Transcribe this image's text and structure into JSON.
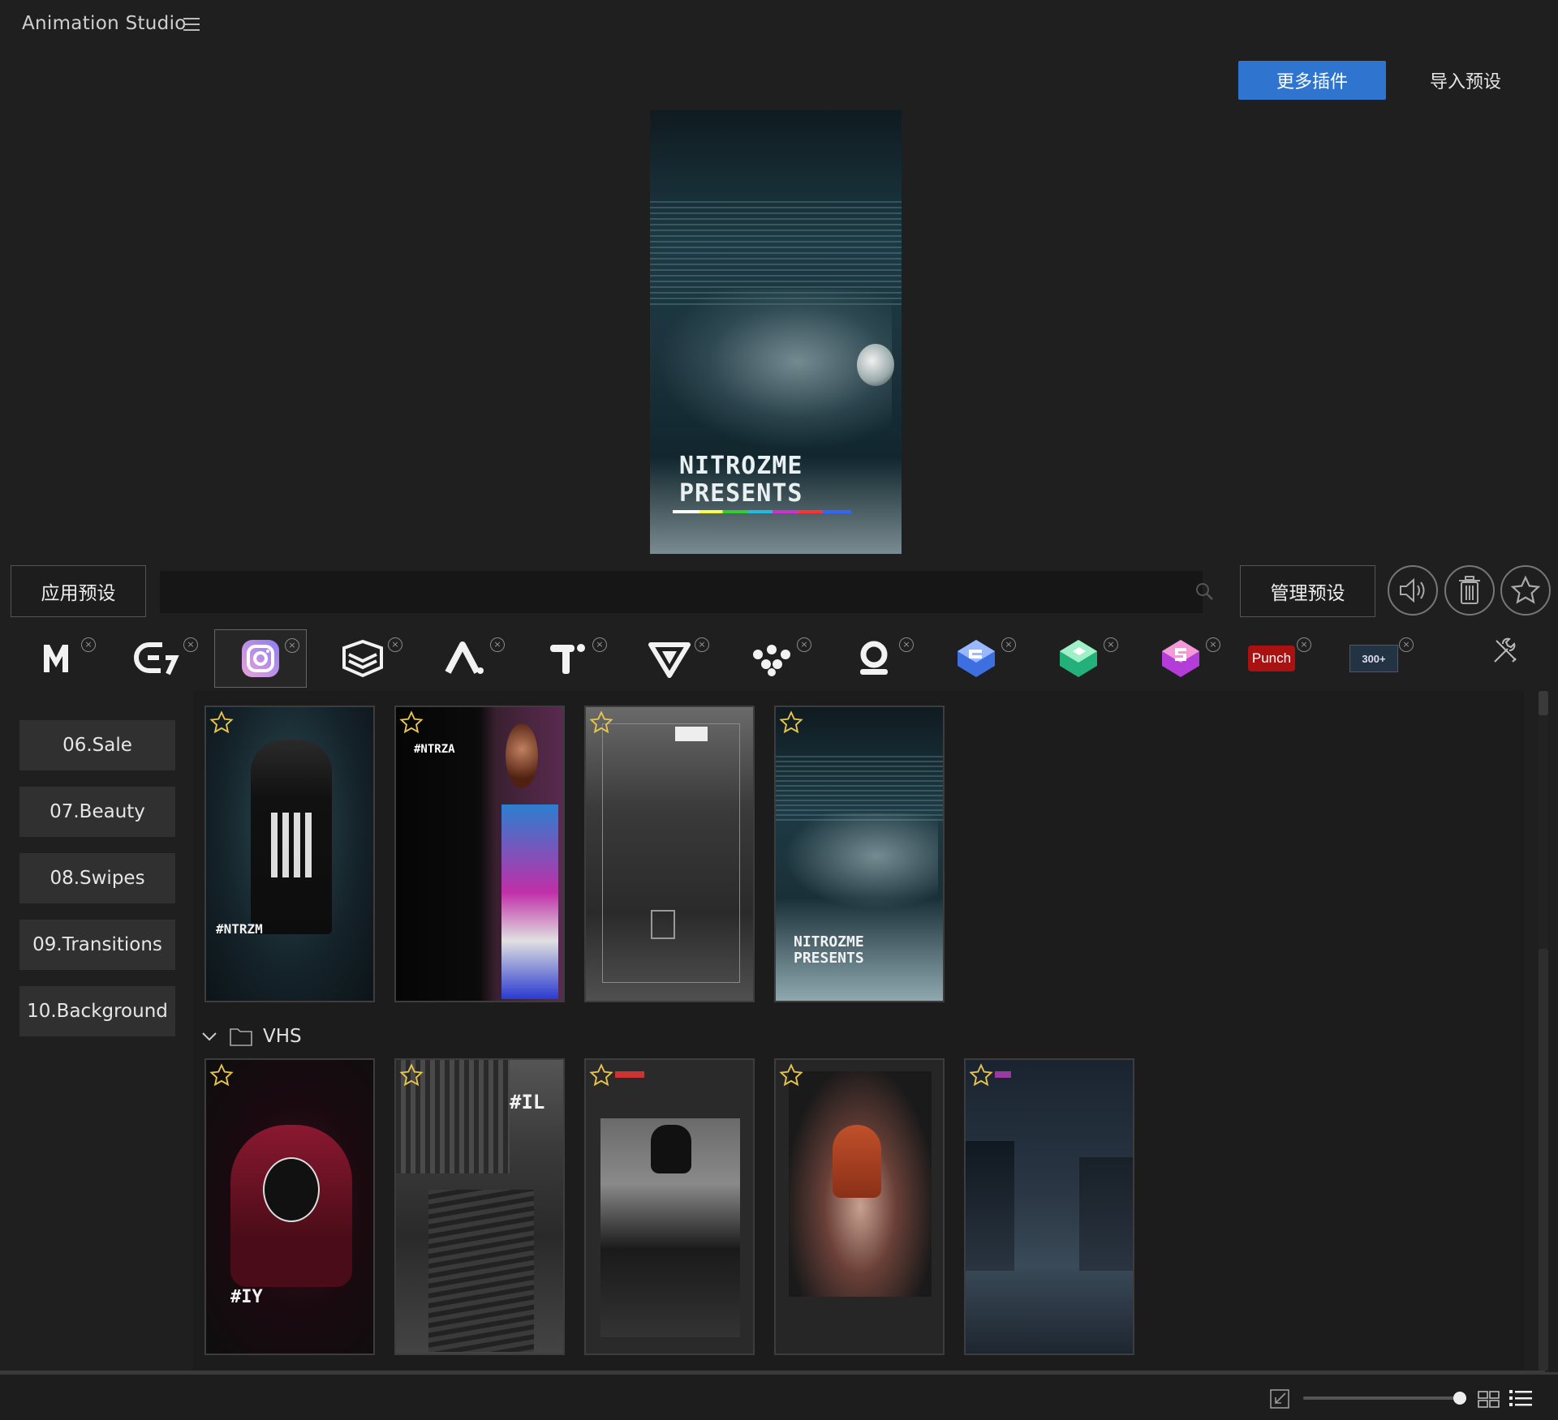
{
  "app": {
    "title": "Animation Studio"
  },
  "header": {
    "more_plugins": "更多插件",
    "import_preset": "导入预设"
  },
  "preview": {
    "line1": "NITROZME",
    "line2": "PRESENTS"
  },
  "toolbar": {
    "apply_preset": "应用预设",
    "manage_preset": "管理预设",
    "search_placeholder": ""
  },
  "plugins": [
    {
      "name": "M",
      "icon": "m-logo-icon"
    },
    {
      "name": "E7",
      "icon": "e7-logo-icon"
    },
    {
      "name": "Instagram",
      "icon": "instagram-icon",
      "active": true
    },
    {
      "name": "Layers",
      "icon": "layers-logo-icon"
    },
    {
      "name": "A",
      "icon": "a-logo-icon"
    },
    {
      "name": "T",
      "icon": "t-logo-icon"
    },
    {
      "name": "V",
      "icon": "v-logo-icon"
    },
    {
      "name": "Dots",
      "icon": "dots-logo-icon"
    },
    {
      "name": "Q",
      "icon": "q-logo-icon"
    },
    {
      "name": "Blue",
      "icon": "blue-cube-icon"
    },
    {
      "name": "Green",
      "icon": "green-cube-icon"
    },
    {
      "name": "Pink",
      "icon": "pink-cube-icon"
    },
    {
      "name": "Punch",
      "icon": "punch-badge",
      "label": "Punch"
    },
    {
      "name": "300+",
      "icon": "transitions-badge",
      "label": "300+"
    }
  ],
  "sidebar": {
    "categories": [
      "06.Sale",
      "07.Beauty",
      "08.Swipes",
      "09.Transitions",
      "10.Background"
    ]
  },
  "gallery": {
    "row1": [
      {
        "label": "#NTRZM"
      },
      {
        "label": "#NTRZA"
      },
      {
        "label": ""
      },
      {
        "label": "NITROZME PRESENTS"
      }
    ],
    "folder": {
      "name": "VHS"
    },
    "row2": [
      {
        "label": "#IY"
      },
      {
        "label": "#IL"
      },
      {
        "label": ""
      },
      {
        "label": ""
      },
      {
        "label": ""
      }
    ]
  },
  "colors": {
    "accent": "#2f74cf",
    "background": "#1f1f1f",
    "star": "#e8c54a"
  }
}
